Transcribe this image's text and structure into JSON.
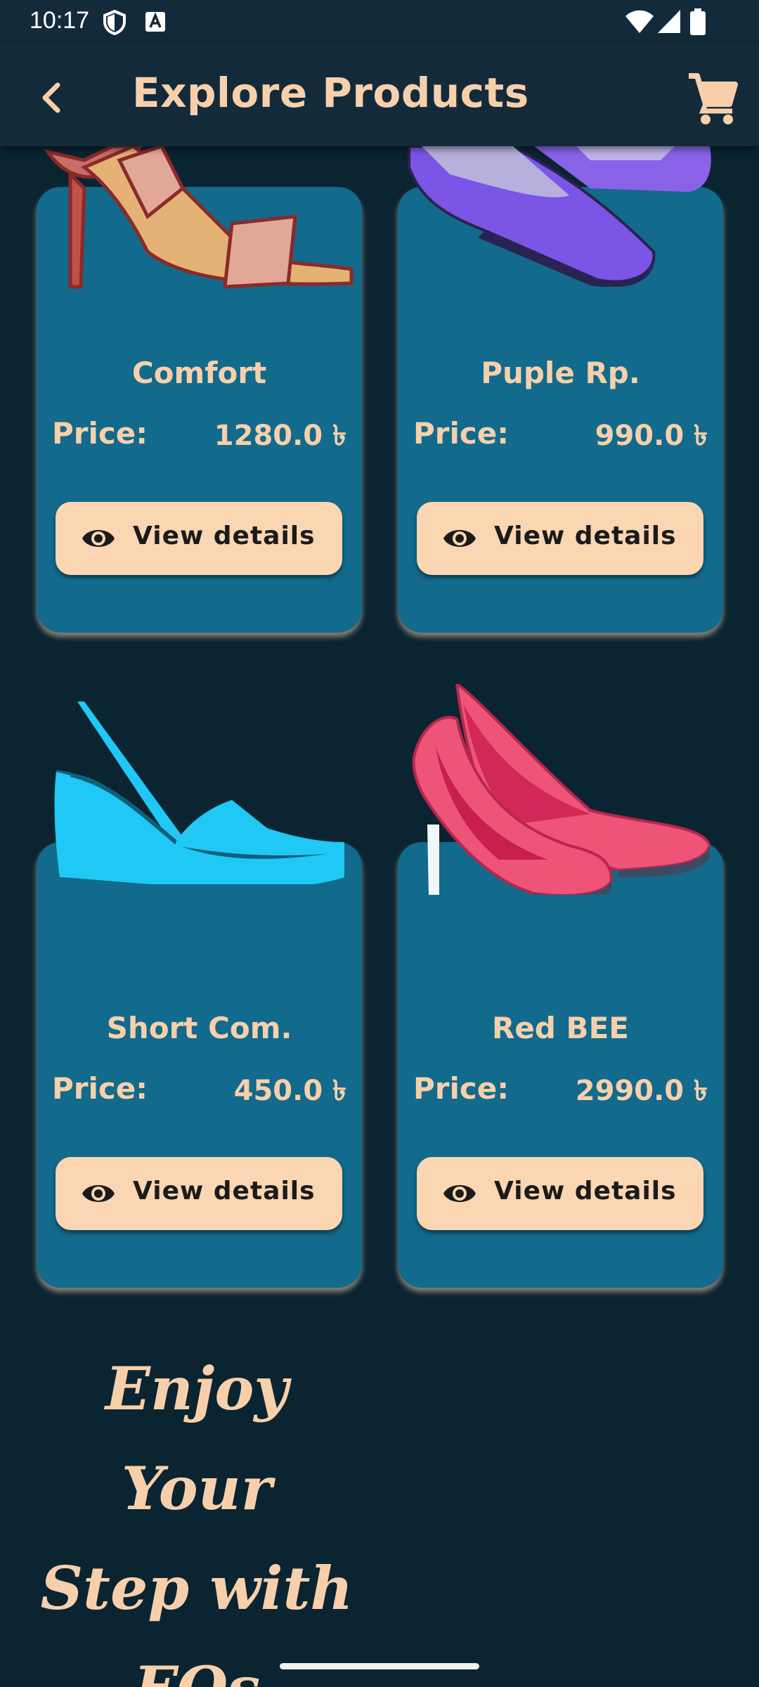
{
  "status_bar": {
    "time": "10:17"
  },
  "app_bar": {
    "title": "Explore Products"
  },
  "products": [
    {
      "name": "Comfort",
      "price_label": "Price:",
      "price": "1280.0 ৳",
      "button_label": "View details"
    },
    {
      "name": "Puple Rp.",
      "price_label": "Price:",
      "price": "990.0 ৳",
      "button_label": "View details"
    },
    {
      "name": "Short Com.",
      "price_label": "Price:",
      "price": "450.0 ৳",
      "button_label": "View details"
    },
    {
      "name": "Red BEE",
      "price_label": "Price:",
      "price": "2990.0 ৳",
      "button_label": "View details"
    }
  ],
  "tagline": {
    "line1": "Enjoy Your",
    "line2": "Step with",
    "line3": "FQs"
  },
  "colors": {
    "background": "#0a2432",
    "app_bar": "#132a3b",
    "card": "#126a8c",
    "accent": "#f7d0ab",
    "button": "#fbd6b2"
  },
  "icons": [
    "back-arrow-icon",
    "cart-icon",
    "eye-icon",
    "shield-icon",
    "keyboard-icon",
    "wifi-icon",
    "signal-icon",
    "battery-icon"
  ]
}
